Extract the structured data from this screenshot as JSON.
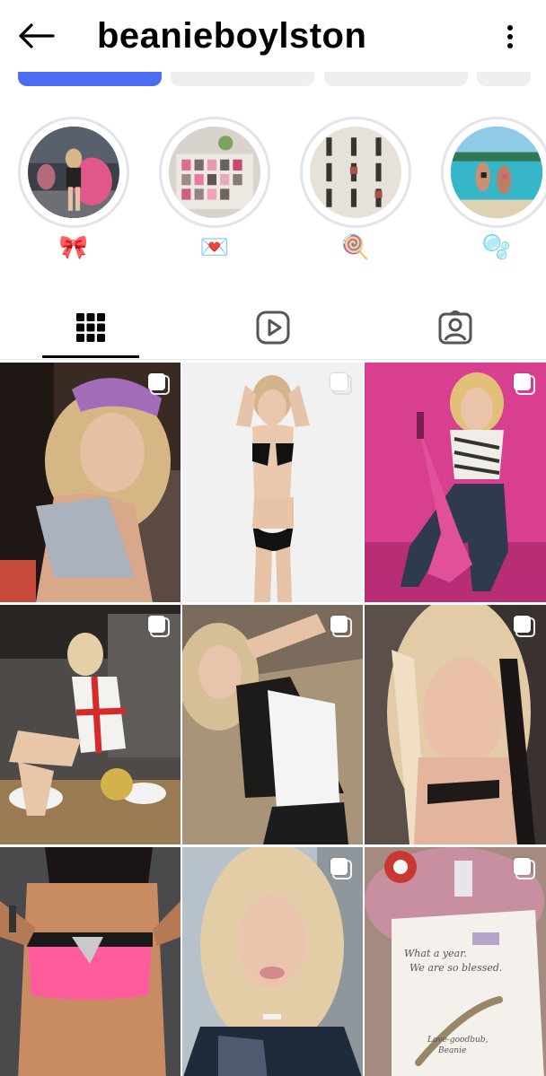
{
  "header": {
    "username": "beanieboylston",
    "back_icon": "arrow-left-icon",
    "more_icon": "more-vertical-icon"
  },
  "highlights": [
    {
      "emoji": "🎀"
    },
    {
      "emoji": "💌"
    },
    {
      "emoji": "🍭"
    },
    {
      "emoji": "🫧"
    }
  ],
  "tabs": [
    {
      "icon": "grid-icon",
      "active": true
    },
    {
      "icon": "reels-icon",
      "active": false
    },
    {
      "icon": "tagged-icon",
      "active": false
    }
  ],
  "colors": {
    "accent_button": "#4c6cf3",
    "secondary_button": "#efeff1",
    "ring": "#e3e3e8",
    "indicator": "#000000"
  },
  "posts": [
    {
      "row": 1,
      "col": 1,
      "multi": true
    },
    {
      "row": 1,
      "col": 2,
      "multi": true
    },
    {
      "row": 1,
      "col": 3,
      "multi": true
    },
    {
      "row": 2,
      "col": 1,
      "multi": true
    },
    {
      "row": 2,
      "col": 2,
      "multi": true
    },
    {
      "row": 2,
      "col": 3,
      "multi": true
    },
    {
      "row": 3,
      "col": 1,
      "multi": false
    },
    {
      "row": 3,
      "col": 2,
      "multi": true
    },
    {
      "row": 3,
      "col": 3,
      "multi": true
    }
  ],
  "note_card": {
    "line1": "What a year.",
    "line2": "We are so blessed.",
    "line3": "Love-goodbub,",
    "line4": "Beanie"
  }
}
